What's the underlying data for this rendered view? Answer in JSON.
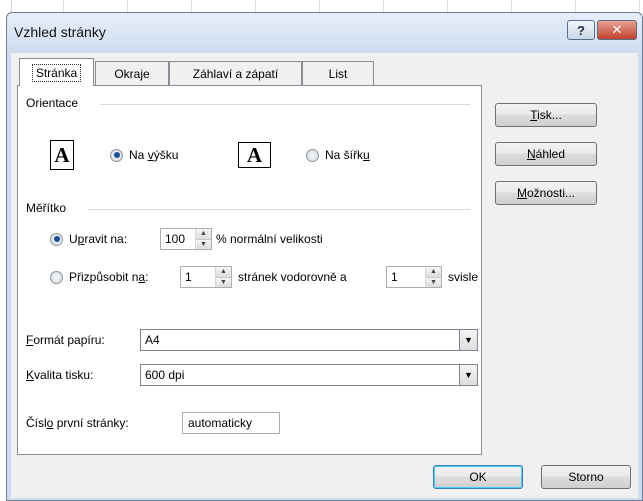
{
  "dialog": {
    "title": "Vzhled stránky",
    "help_label": "?",
    "close_label": "✕"
  },
  "tabs": [
    {
      "label": "Stránka",
      "active": true
    },
    {
      "label": "Okraje",
      "active": false
    },
    {
      "label": "Záhlaví a zápatí",
      "active": false
    },
    {
      "label": "List",
      "active": false
    }
  ],
  "orientation": {
    "group_label": "Orientace",
    "icon_glyph": "A",
    "portrait_label_pre": "Na ",
    "portrait_label_u": "v",
    "portrait_label_post": "ýšku",
    "portrait_checked": true,
    "landscape_label_pre": "Na šířk",
    "landscape_label_u": "u",
    "landscape_label_post": "",
    "landscape_checked": false
  },
  "scale": {
    "group_label": "Měřítko",
    "adjust_label_pre": "U",
    "adjust_label_u": "p",
    "adjust_label_post": "ravit na:",
    "adjust_checked": true,
    "adjust_value": "100",
    "adjust_suffix": "% normální velikosti",
    "fit_label_pre": "Přizpůsobit n",
    "fit_label_u": "a",
    "fit_label_post": ":",
    "fit_checked": false,
    "fit_wide_value": "1",
    "fit_wide_suffix": "stránek vodorovně a",
    "fit_tall_value": "1",
    "fit_tall_suffix": "svisle"
  },
  "paper": {
    "format_label_u": "F",
    "format_label_post": "ormát papíru:",
    "format_value": "A4",
    "quality_label_u": "K",
    "quality_label_post": "valita tisku:",
    "quality_value": "600 dpi",
    "first_page_label_pre": "Čísl",
    "first_page_label_u": "o",
    "first_page_label_post": " první stránky:",
    "first_page_value": "automaticky"
  },
  "side_buttons": {
    "print_u": "T",
    "print_post": "isk...",
    "preview_u": "N",
    "preview_post": "áhled",
    "options_u": "M",
    "options_post": "ožnosti..."
  },
  "footer": {
    "ok_label": "OK",
    "cancel_label": "Storno"
  },
  "spin_up": "▲",
  "spin_down": "▼",
  "dropdown_arrow": "▼"
}
